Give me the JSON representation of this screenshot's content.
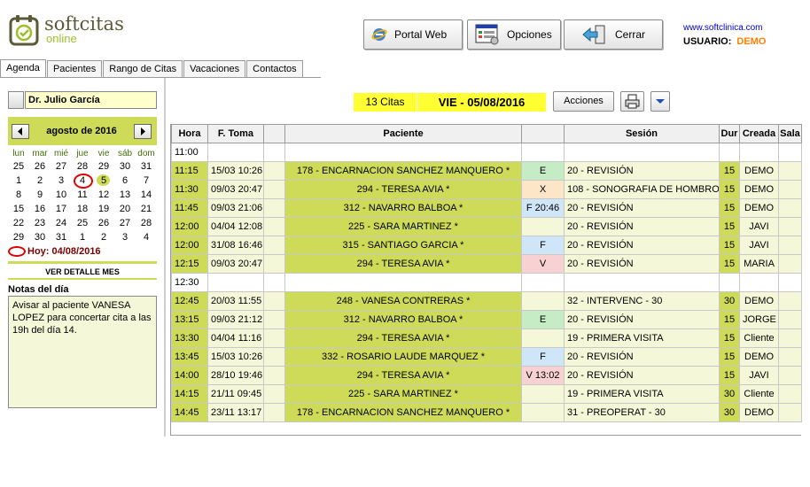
{
  "header": {
    "logo_main": "softcitas",
    "logo_sub": "online",
    "buttons": {
      "portal": "Portal Web",
      "opciones": "Opciones",
      "cerrar": "Cerrar"
    },
    "site": "www.softclinica.com",
    "user_label": "USUARIO:",
    "user_value": "DEMO"
  },
  "tabs": [
    "Agenda",
    "Pacientes",
    "Rango de Citas",
    "Vacaciones",
    "Contactos"
  ],
  "left": {
    "doctor": "Dr. Julio García",
    "calendar": {
      "title": "agosto de 2016",
      "weekdays": [
        "lun",
        "mar",
        "mié",
        "jue",
        "vie",
        "sáb",
        "dom"
      ],
      "days": [
        "25",
        "26",
        "27",
        "28",
        "29",
        "30",
        "31",
        "1",
        "2",
        "3",
        "4",
        "5",
        "6",
        "7",
        "8",
        "9",
        "10",
        "11",
        "12",
        "13",
        "14",
        "15",
        "16",
        "17",
        "18",
        "19",
        "20",
        "21",
        "22",
        "23",
        "24",
        "25",
        "26",
        "27",
        "28",
        "29",
        "30",
        "31",
        "1",
        "2",
        "3",
        "4"
      ],
      "today_day": "4",
      "selected_day": "5",
      "hoy_text": "Hoy: 04/08/2016"
    },
    "ver_detalle": "VER DETALLE MES",
    "notas_label": "Notas del día",
    "notas_text": "Avisar al paciente VANESA LOPEZ para concertar cita a las 19h del día 14."
  },
  "toolbar": {
    "count": "13 Citas",
    "date": "VIE - 05/08/2016",
    "acciones": "Acciones"
  },
  "table": {
    "headers": {
      "hora": "Hora",
      "ftoma": "F. Toma",
      "paciente": "Paciente",
      "sesion": "Sesión",
      "dur": "Dur",
      "creada": "Creada",
      "sala": "Sala"
    },
    "rows": [
      {
        "hora": "11:00",
        "free": true
      },
      {
        "hora": "11:15",
        "ftoma": "15/03 10:26",
        "paciente": "178 - ENCARNACION SANCHEZ MANQUERO  *",
        "code": "E",
        "ctype": "E",
        "sesion": "20 - REVISIÓN",
        "dur": "15",
        "creada": "DEMO"
      },
      {
        "hora": "11:30",
        "ftoma": "09/03 20:47",
        "paciente": "294 - TERESA AVIA  *",
        "code": "X",
        "ctype": "X",
        "sesion": "108 - SONOGRAFIA DE HOMBRO",
        "dur": "15",
        "creada": "DEMO"
      },
      {
        "hora": "11:45",
        "ftoma": "09/03 21:06",
        "paciente": "312 - NAVARRO BALBOA  *",
        "code": "F  20:46",
        "ctype": "F",
        "sesion": "20 - REVISIÓN",
        "dur": "15",
        "creada": "DEMO"
      },
      {
        "hora": "12:00",
        "ftoma": "04/04 12:08",
        "paciente": "225 - SARA MARTINEZ  *",
        "code": "",
        "ctype": "none",
        "sesion": "20 - REVISIÓN",
        "dur": "15",
        "creada": "JAVI"
      },
      {
        "hora": "12:00",
        "ftoma": "31/08 16:46",
        "paciente": "315 - SANTIAGO  GARCIA  *",
        "code": "F",
        "ctype": "F",
        "sesion": "20 - REVISIÓN",
        "dur": "15",
        "creada": "JAVI"
      },
      {
        "hora": "12:15",
        "ftoma": "09/03 20:47",
        "paciente": "294 - TERESA AVIA  *",
        "code": "V",
        "ctype": "V",
        "sesion": "20 - REVISIÓN",
        "dur": "15",
        "creada": "MARIA"
      },
      {
        "hora": "12:30",
        "free": true
      },
      {
        "hora": "12:45",
        "ftoma": "20/03 11:55",
        "paciente": "248 - VANESA CONTRERAS  *",
        "code": "",
        "ctype": "none",
        "sesion": "32 - INTERVENC - 30",
        "dur": "30",
        "creada": "DEMO"
      },
      {
        "hora": "13:15",
        "ftoma": "09/03 21:12",
        "paciente": "312 - NAVARRO BALBOA  *",
        "code": "E",
        "ctype": "E",
        "sesion": "20 - REVISIÓN",
        "dur": "15",
        "creada": "JORGE"
      },
      {
        "hora": "13:30",
        "ftoma": "04/04 11:16",
        "paciente": "294 - TERESA AVIA  *",
        "code": "",
        "ctype": "none",
        "sesion": "19 - PRIMERA VISITA",
        "dur": "15",
        "creada": "Cliente"
      },
      {
        "hora": "13:45",
        "ftoma": "15/03 10:26",
        "paciente": "332 - ROSARIO LAUDE MARQUEZ  *",
        "code": "F",
        "ctype": "F",
        "sesion": "20 - REVISIÓN",
        "dur": "15",
        "creada": "DEMO"
      },
      {
        "hora": "14:00",
        "ftoma": "28/10 19:46",
        "paciente": "294 - TERESA AVIA  *",
        "code": "V  13:02",
        "ctype": "V",
        "sesion": "20 - REVISIÓN",
        "dur": "15",
        "creada": "JAVI"
      },
      {
        "hora": "14:15",
        "ftoma": "21/11 09:45",
        "paciente": "225 - SARA MARTINEZ  *",
        "code": "",
        "ctype": "none",
        "sesion": "19 - PRIMERA VISITA",
        "dur": "30",
        "creada": "Cliente"
      },
      {
        "hora": "14:45",
        "ftoma": "23/11 13:17",
        "paciente": "178 - ENCARNACION SANCHEZ MANQUERO  *",
        "code": "",
        "ctype": "none",
        "sesion": "31 - PREOPERAT - 30",
        "dur": "30",
        "creada": "DEMO"
      }
    ]
  },
  "colors": {
    "accent_green": "#cddb59",
    "light_green": "#f5f8d8",
    "highlight_yellow": "#ffff33",
    "user_orange": "#ff7f00"
  }
}
